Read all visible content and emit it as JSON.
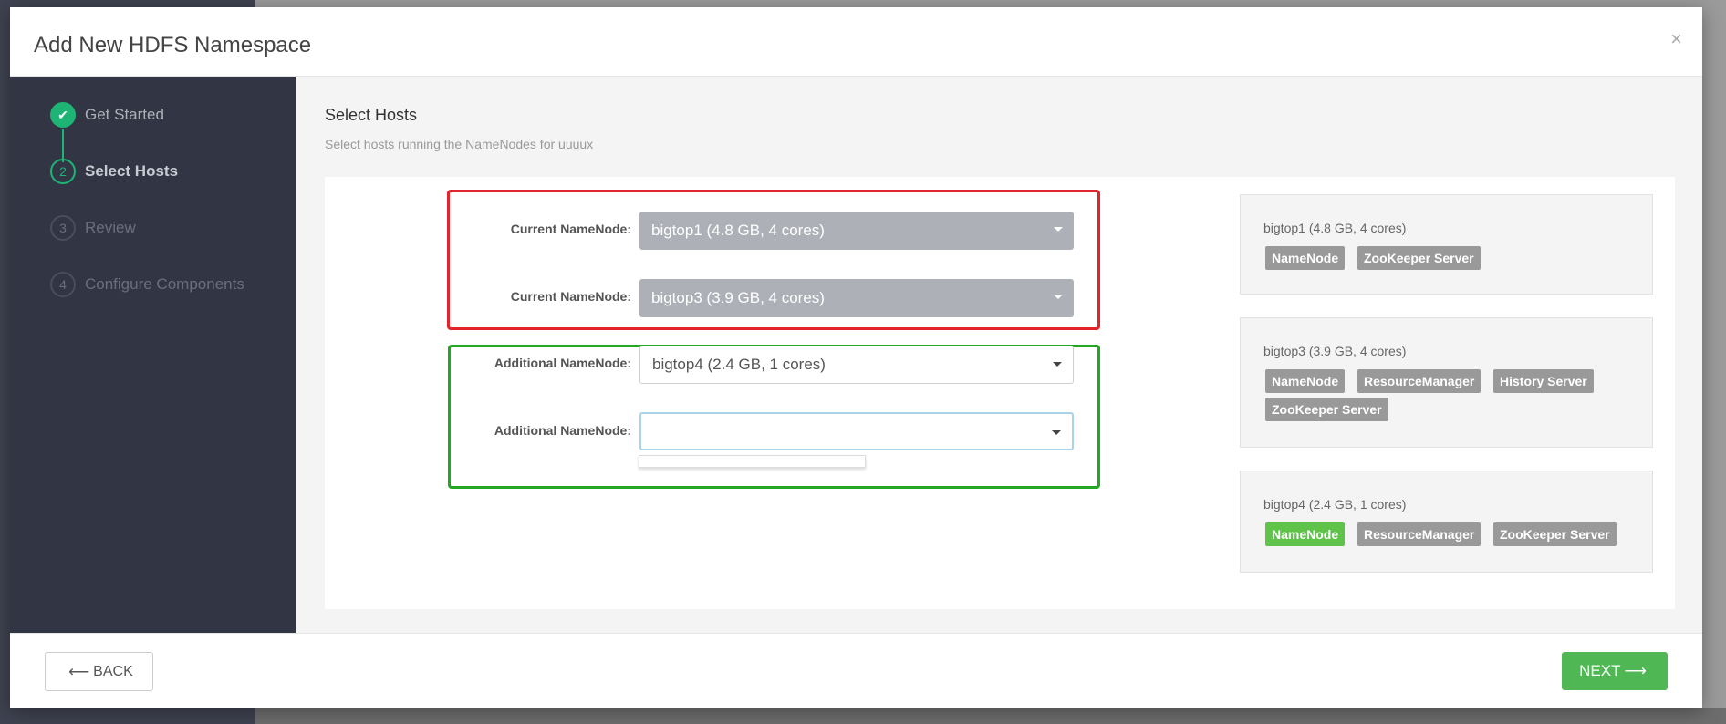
{
  "modal": {
    "title": "Add New HDFS Namespace",
    "close_glyph": "×"
  },
  "steps": [
    {
      "number": "✔",
      "label": "Get Started",
      "state": "done"
    },
    {
      "number": "2",
      "label": "Select Hosts",
      "state": "active"
    },
    {
      "number": "3",
      "label": "Review",
      "state": "pending"
    },
    {
      "number": "4",
      "label": "Configure Components",
      "state": "pending"
    }
  ],
  "content": {
    "title": "Select Hosts",
    "subtitle": "Select hosts running the NameNodes for uuuux"
  },
  "namenodes": {
    "current": [
      {
        "label": "Current NameNode:",
        "value": "bigtop1 (4.8 GB, 4 cores)"
      },
      {
        "label": "Current NameNode:",
        "value": "bigtop3 (3.9 GB, 4 cores)"
      }
    ],
    "additional": [
      {
        "label": "Additional NameNode:",
        "value": "bigtop4 (2.4 GB, 1 cores)"
      },
      {
        "label": "Additional NameNode:",
        "value": ""
      }
    ]
  },
  "hosts": [
    {
      "name": "bigtop1 (4.8 GB, 4 cores)",
      "components": [
        "NameNode",
        "ZooKeeper Server"
      ]
    },
    {
      "name": "bigtop3 (3.9 GB, 4 cores)",
      "components": [
        "NameNode",
        "ResourceManager",
        "History Server",
        "ZooKeeper Server"
      ]
    },
    {
      "name": "bigtop4 (2.4 GB, 1 cores)",
      "components": [
        "NameNode",
        "ResourceManager",
        "ZooKeeper Server"
      ],
      "highlighted": "NameNode"
    }
  ],
  "footer": {
    "back_label": "BACK",
    "next_label": "NEXT",
    "back_arrow": "⟵",
    "next_arrow": "⟶"
  },
  "colors": {
    "accent_green": "#1eb475",
    "next_button": "#4fb855",
    "highlight_tag": "#5fc34a",
    "frame_red": "#e5232b",
    "frame_green": "#22a722",
    "sidebar_bg": "#323544"
  }
}
